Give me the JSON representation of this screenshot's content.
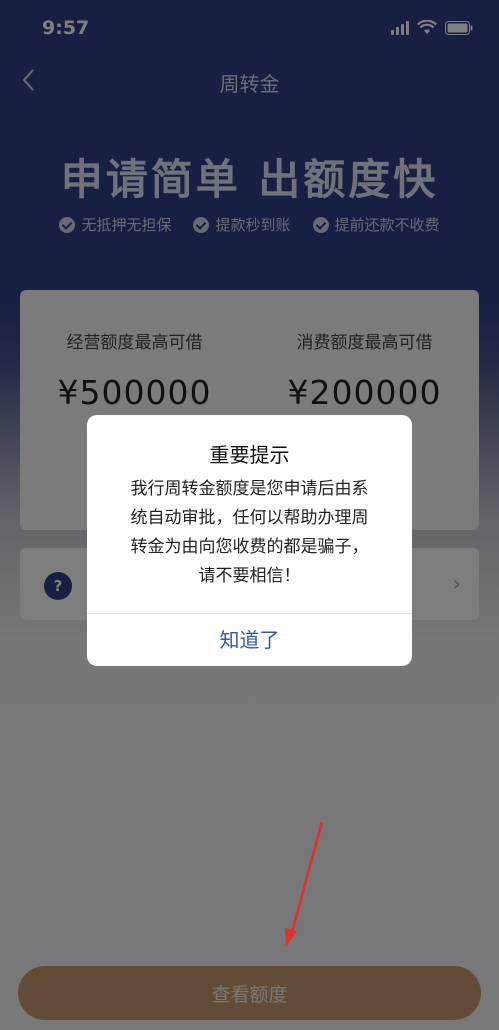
{
  "status_bar": {
    "time": "9:57"
  },
  "nav": {
    "title": "周转金"
  },
  "hero": {
    "title": "申请简单  出额度快",
    "features": [
      "无抵押无担保",
      "提款秒到账",
      "提前还款不收费"
    ]
  },
  "quota": {
    "business": {
      "label": "经营额度最高可借",
      "value": "¥500000"
    },
    "consumer": {
      "label": "消费额度最高可借",
      "value": "¥200000"
    }
  },
  "help": {
    "icon_text": "?"
  },
  "dialog": {
    "title": "重要提示",
    "message_lines": [
      "我行周转金额度是您申请后由系",
      "统自动审批，任何以帮助办理周",
      "转金为由向您收费的都是骗子，",
      "请不要相信！"
    ],
    "confirm_label": "知道了"
  },
  "footer": {
    "button_label": "查看额度"
  },
  "colors": {
    "brand_blue": "#2e3f86",
    "button_gold": "#c4986e",
    "annotation_red": "#e0302a"
  }
}
